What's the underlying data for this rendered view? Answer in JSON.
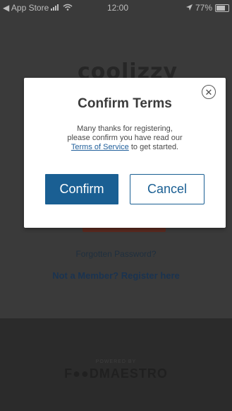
{
  "status_bar": {
    "back_app": "◀ App Store",
    "time": "12:00",
    "battery": "77%",
    "signal_icon": "signal-icon",
    "wifi_icon": "wifi-icon",
    "location_icon": "location-arrow-icon"
  },
  "background": {
    "logo_partial": "coolizzy",
    "forgot_password": "Forgotten Password?",
    "register": "Not a Member? Register here",
    "powered_by": "POWERED BY",
    "brand": "F●●DMAESTRO"
  },
  "modal": {
    "title": "Confirm Terms",
    "body_line1": "Many thanks for registering,",
    "body_line2": "please confirm you have read our",
    "terms_link": "Terms of Service",
    "body_line3_suffix": " to get started.",
    "confirm_label": "Confirm",
    "cancel_label": "Cancel",
    "close_symbol": "✕"
  },
  "colors": {
    "primary": "#1a5f93",
    "overlay": "#3a3a3a"
  }
}
